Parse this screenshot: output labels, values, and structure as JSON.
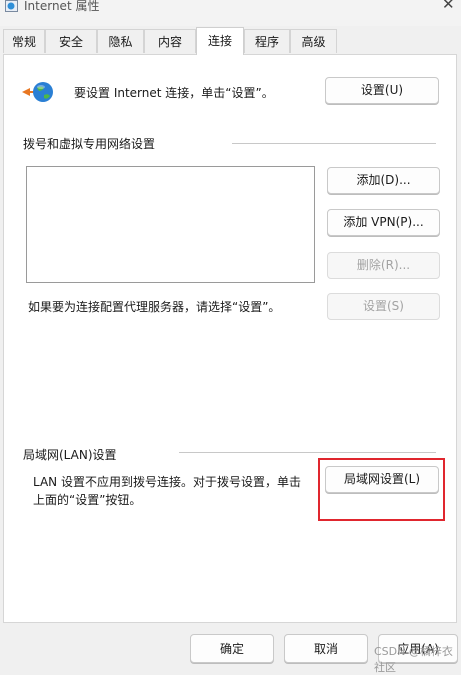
{
  "window": {
    "title": "Internet 属性",
    "close_glyph": "✕"
  },
  "tabs": [
    {
      "label": "常规"
    },
    {
      "label": "安全"
    },
    {
      "label": "隐私"
    },
    {
      "label": "内容"
    },
    {
      "label": "连接",
      "selected": true
    },
    {
      "label": "程序"
    },
    {
      "label": "高级"
    }
  ],
  "setup": {
    "text": "要设置 Internet 连接，单击“设置”。",
    "button_label": "设置(U)"
  },
  "dialup": {
    "heading": "拨号和虚拟专用网络设置",
    "add_label": "添加(D)...",
    "add_vpn_label": "添加 VPN(P)...",
    "remove_label": "删除(R)...",
    "proxy_hint": "如果要为连接配置代理服务器，请选择“设置”。",
    "settings_label": "设置(S)"
  },
  "lan": {
    "heading": "局域网(LAN)设置",
    "desc_line1": "LAN 设置不应用到拨号连接。对于拨号设置，单击",
    "desc_line2": "上面的“设置”按钮。",
    "button_label": "局域网设置(L)"
  },
  "footer": {
    "ok_label": "确定",
    "cancel_label": "取消",
    "apply_label": "应用(A)"
  },
  "watermark": "CSDN @橘梓衣社区",
  "colors": {
    "highlight": "#e0262e",
    "disabled_text": "#a3a3a3"
  }
}
